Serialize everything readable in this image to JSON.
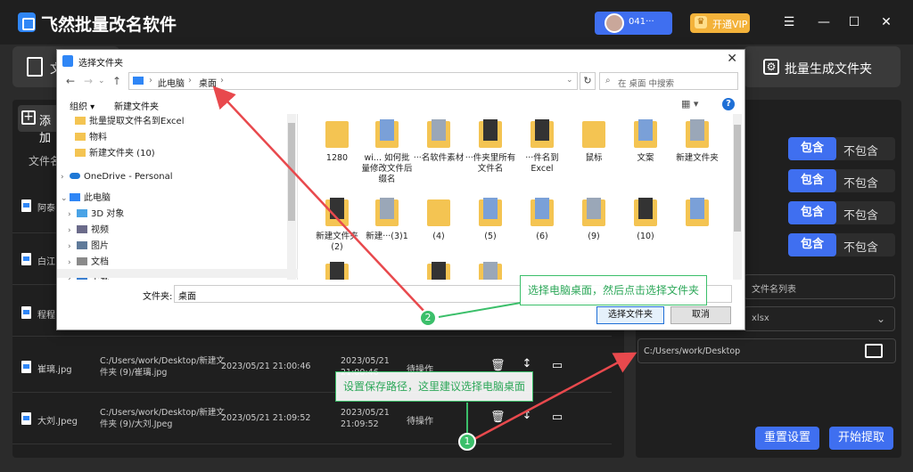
{
  "app": {
    "title": "飞然批量改名软件",
    "user_name": "041···",
    "vip_label": "开通VIP",
    "win_menu": "☰",
    "win_min": "—",
    "win_max": "☐",
    "win_close": "✕"
  },
  "toolbar": {
    "left_label": "文",
    "right_label": "批量生成文件夹"
  },
  "left": {
    "add_label": "添加",
    "col_header": "文件名",
    "rows": [
      {
        "name": "阿泰.",
        "path": "",
        "date": "",
        "date2": "",
        "status": ""
      },
      {
        "name": "白江.",
        "path": "",
        "date": "",
        "date2": "",
        "status": ""
      },
      {
        "name": "程程.",
        "path": "",
        "date": "",
        "date2": "",
        "status": ""
      },
      {
        "name": "崔璃.jpg",
        "path": "C:/Users/work/Desktop/新建文件夹 (9)/崔璃.jpg",
        "date": "2023/05/21 21:00:46",
        "date2": "2023/05/21 21:00:46",
        "status": "待操作"
      },
      {
        "name": "大刘.Jpeg",
        "path": "C:/Users/work/Desktop/新建文件夹 (9)/大刘.Jpeg",
        "date": "2023/05/21 21:09:52",
        "date2": "2023/05/21 21:09:52",
        "status": "待操作"
      }
    ]
  },
  "right": {
    "toggles": [
      {
        "on": "包含",
        "off": "不包含"
      },
      {
        "on": "包含",
        "off": "不包含"
      },
      {
        "on": "包含",
        "off": "不包含"
      },
      {
        "on": "包含",
        "off": "不包含"
      }
    ],
    "list_field": "文件名列表",
    "format_field": "xlsx",
    "save_path": "C:/Users/work/Desktop",
    "reset_label": "重置设置",
    "start_label": "开始提取"
  },
  "dialog": {
    "title": "选择文件夹",
    "close": "✕",
    "crumbs": [
      "此电脑",
      "›",
      "桌面",
      "›"
    ],
    "search_placeholder": "在 桌面 中搜索",
    "organize": "组织 ▾",
    "new_folder": "新建文件夹",
    "nav_items": [
      "批量提取文件名到Excel",
      "物料",
      "新建文件夹 (10)",
      "OneDrive - Personal",
      "此电脑",
      "3D 对象",
      "视频",
      "图片",
      "文档",
      "下载"
    ],
    "files": [
      {
        "label": "1280"
      },
      {
        "label": "wi... 如何批量修改文件后缀名"
      },
      {
        "label": "···名软件素材"
      },
      {
        "label": "···件夹里所有文件名"
      },
      {
        "label": "···件名到Excel"
      },
      {
        "label": "鼠标"
      },
      {
        "label": "文案"
      },
      {
        "label": "新建文件夹"
      },
      {
        "label": "新建文件夹 (2)"
      },
      {
        "label": "新建···(3)1"
      },
      {
        "label": "(4)"
      },
      {
        "label": "(5)"
      },
      {
        "label": "(6)"
      },
      {
        "label": "(9)"
      },
      {
        "label": "(10)"
      }
    ],
    "folder_label": "文件夹:",
    "folder_value": "桌面",
    "select_button": "选择文件夹",
    "cancel_button": "取消"
  },
  "annotations": {
    "step1_text": "设置保存路径，这里建议选择电脑桌面",
    "step1_num": "1",
    "step2_text": "选择电脑桌面，然后点击选择文件夹",
    "step2_num": "2"
  },
  "colors": {
    "accent": "#3f6ff0",
    "annotation_green": "#3bbf6a",
    "arrow_red": "#e8494d"
  }
}
